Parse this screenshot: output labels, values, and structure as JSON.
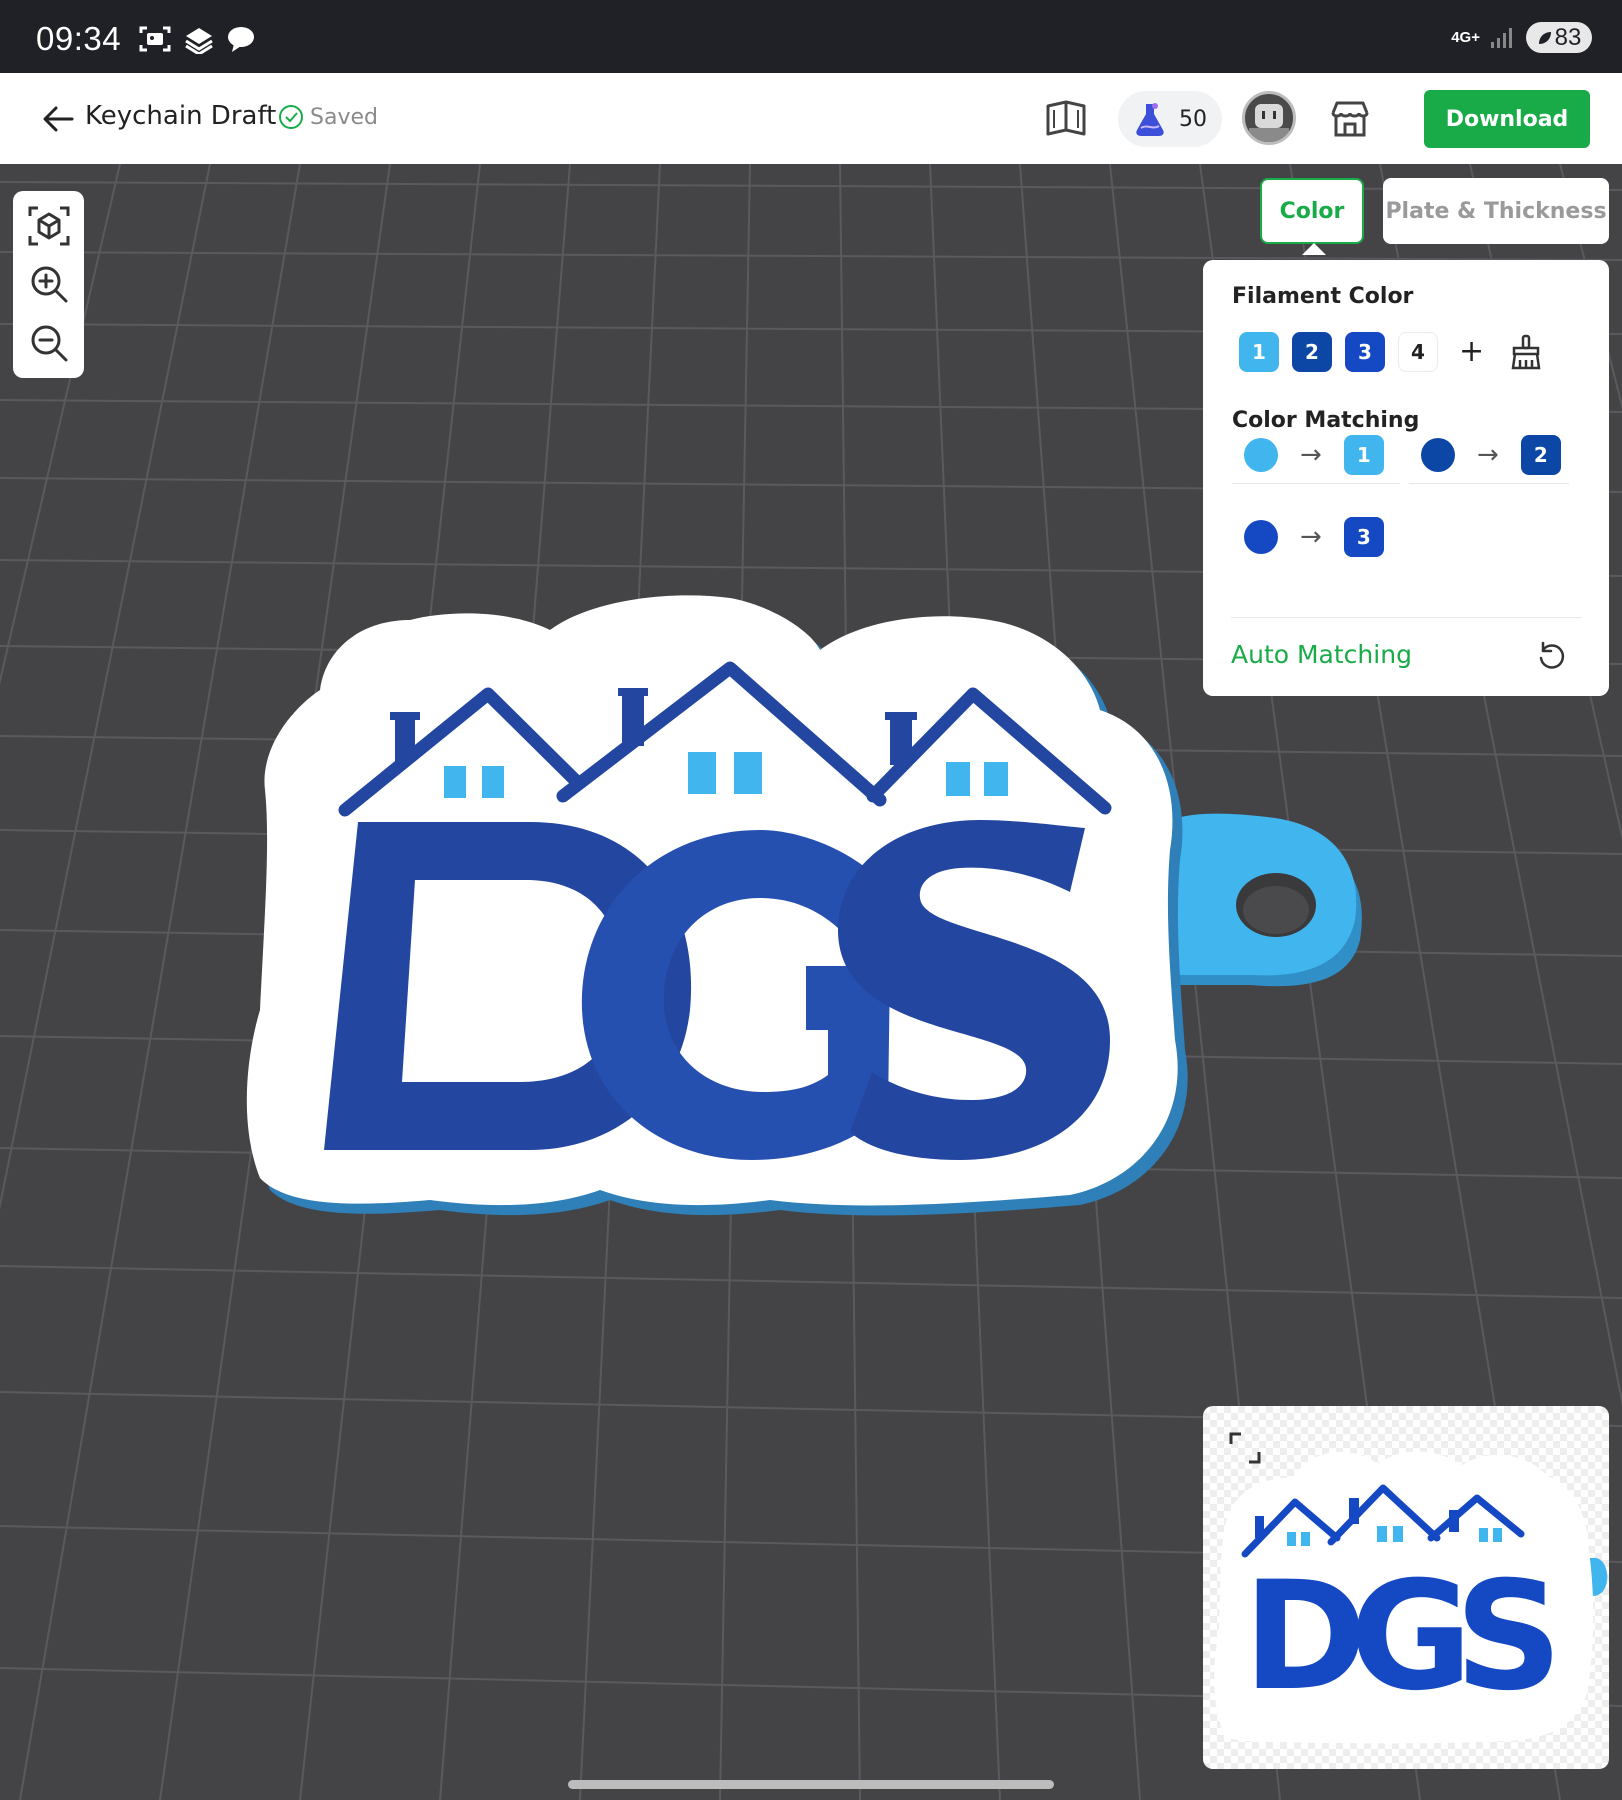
{
  "status_bar": {
    "time": "09:34",
    "network": "4G+",
    "battery": "83",
    "icons": [
      "screenshot-icon",
      "stack-icon",
      "chat-icon",
      "signal-icon",
      "battery-icon"
    ]
  },
  "header": {
    "title": "Keychain Draft",
    "saved_label": "Saved",
    "credits": "50",
    "download_label": "Download"
  },
  "tabs": {
    "color": "Color",
    "plate": "Plate & Thickness"
  },
  "panel": {
    "filament_title": "Filament Color",
    "filaments": [
      {
        "label": "1",
        "color": "#41b5ee"
      },
      {
        "label": "2",
        "color": "#0d47a5"
      },
      {
        "label": "3",
        "color": "#1549c4"
      },
      {
        "label": "4",
        "color": "#ffffff"
      }
    ],
    "add_label": "+",
    "matching_title": "Color Matching",
    "matches": [
      {
        "source": "#41b5ee",
        "target": "1"
      },
      {
        "source": "#0d47a5",
        "target": "2"
      },
      {
        "source": "#1549c4",
        "target": "3"
      }
    ],
    "auto_label": "Auto Matching"
  },
  "model": {
    "text": "DGS"
  },
  "colors": {
    "accent": "#1aab49",
    "canvas": "#444446",
    "plate": "#ffffff",
    "dark_blue": "#2347a0",
    "light_blue": "#41b5ee"
  }
}
